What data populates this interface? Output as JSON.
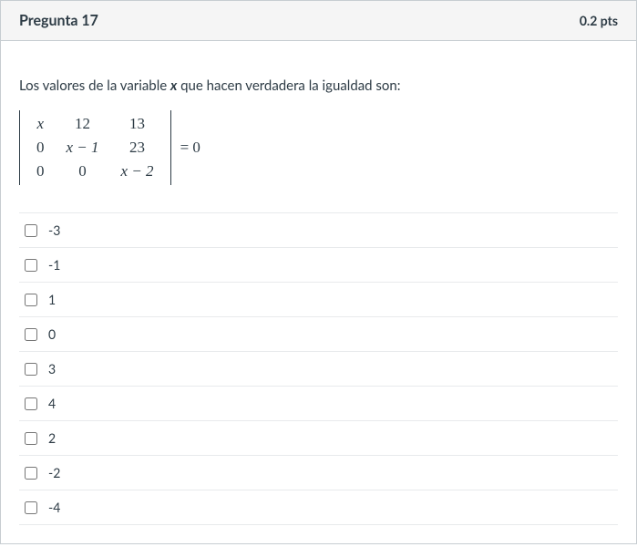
{
  "header": {
    "title": "Pregunta 17",
    "points": "0.2 pts"
  },
  "prompt": {
    "before_var": "Los valores de la variable ",
    "var": "x",
    "after_var": " que hacen verdadera la igualdad son:"
  },
  "matrix": {
    "r1c1": "x",
    "r1c2": "12",
    "r1c3": "13",
    "r2c1": "0",
    "r2c2": "x − 1",
    "r2c3": "23",
    "r3c1": "0",
    "r3c2": "0",
    "r3c3": "x − 2"
  },
  "equation_rhs": "= 0",
  "options": [
    {
      "label": "-3"
    },
    {
      "label": "-1"
    },
    {
      "label": "1"
    },
    {
      "label": "0"
    },
    {
      "label": "3"
    },
    {
      "label": "4"
    },
    {
      "label": "2"
    },
    {
      "label": "-2"
    },
    {
      "label": "-4"
    }
  ]
}
